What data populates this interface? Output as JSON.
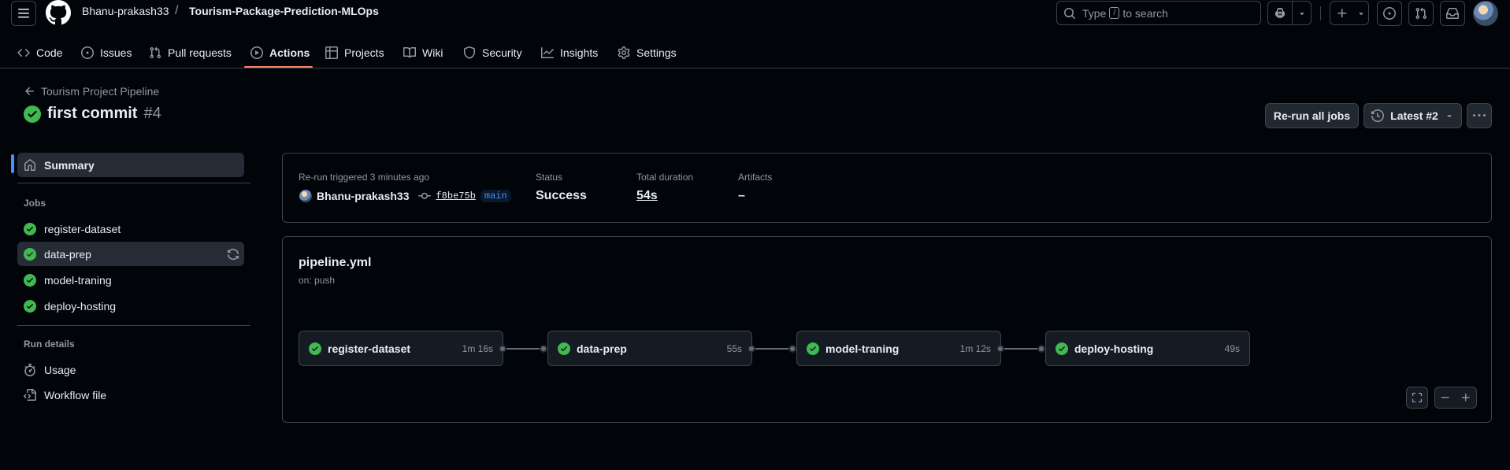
{
  "header": {
    "owner": "Bhanu-prakash33",
    "separator": "/",
    "repo": "Tourism-Package-Prediction-MLOps",
    "search_prefix": "Type",
    "search_key": "/",
    "search_suffix": "to search"
  },
  "tabs": [
    {
      "label": "Code",
      "icon": "code-icon"
    },
    {
      "label": "Issues",
      "icon": "issue-icon"
    },
    {
      "label": "Pull requests",
      "icon": "pull-request-icon"
    },
    {
      "label": "Actions",
      "icon": "play-icon",
      "active": true
    },
    {
      "label": "Projects",
      "icon": "table-icon"
    },
    {
      "label": "Wiki",
      "icon": "book-icon"
    },
    {
      "label": "Security",
      "icon": "shield-icon"
    },
    {
      "label": "Insights",
      "icon": "graph-icon"
    },
    {
      "label": "Settings",
      "icon": "gear-icon"
    }
  ],
  "run": {
    "workflow_link": "Tourism Project Pipeline",
    "title": "first commit",
    "number": "#4",
    "rerun_button": "Re-run all jobs",
    "attempt_button": "Latest #2"
  },
  "sidebar": {
    "summary": "Summary",
    "jobs_heading": "Jobs",
    "jobs": [
      "register-dataset",
      "data-prep",
      "model-traning",
      "deploy-hosting"
    ],
    "run_details_heading": "Run details",
    "usage": "Usage",
    "workflow_file": "Workflow file"
  },
  "summary": {
    "trigger_text": "Re-run triggered 3 minutes ago",
    "actor": "Bhanu-prakash33",
    "sha": "f8be75b",
    "branch": "main",
    "status_label": "Status",
    "status_value": "Success",
    "duration_label": "Total duration",
    "duration_value": "54s",
    "artifacts_label": "Artifacts",
    "artifacts_value": "–"
  },
  "graph": {
    "file": "pipeline.yml",
    "trigger": "on: push",
    "jobs": [
      {
        "name": "register-dataset",
        "duration": "1m 16s"
      },
      {
        "name": "data-prep",
        "duration": "55s"
      },
      {
        "name": "model-traning",
        "duration": "1m 12s"
      },
      {
        "name": "deploy-hosting",
        "duration": "49s"
      }
    ]
  },
  "colors": {
    "success": "#3fb950",
    "accent_underline": "#f78166",
    "link_blue": "#4493f8"
  }
}
